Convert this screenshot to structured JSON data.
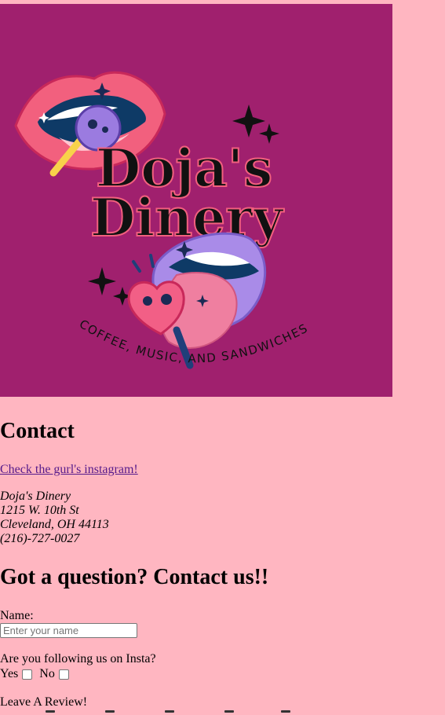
{
  "logo": {
    "line1": "Doja's",
    "line2": "Dinery",
    "tagline": "COFFEE, MUSIC, AND SANDWICHES",
    "background": "#a0206e"
  },
  "contact": {
    "heading": "Contact",
    "instagram_link": "Check the gurl's instagram!",
    "address": {
      "name": "Doja's Dinery",
      "street": "1215 W. 10th St",
      "city": "Cleveland, OH 44113",
      "phone": "(216)-727-0027"
    }
  },
  "form": {
    "heading": "Got a question? Contact us!!",
    "name_label": "Name:",
    "name_placeholder": "Enter your name",
    "insta_question": "Are you following us on Insta?",
    "yes_label": "Yes",
    "no_label": "No",
    "review_label": "Leave A Review!"
  },
  "colors": {
    "page_background": "#ffb6c1",
    "logo_background": "#a0206e",
    "link": "#551a8b"
  }
}
